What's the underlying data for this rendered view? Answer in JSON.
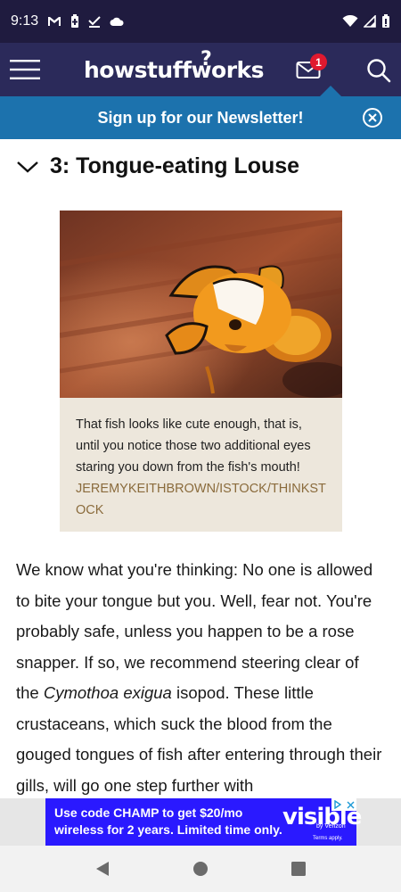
{
  "status_bar": {
    "time": "9:13",
    "left_icons": [
      "gmail-icon",
      "battery-saver-icon",
      "download-done-icon",
      "cloud-icon"
    ],
    "right_icons": [
      "wifi-icon",
      "signal-icon",
      "battery-icon"
    ]
  },
  "header": {
    "logo_text": "howstuffworks",
    "mail_badge_count": "1",
    "colors": {
      "header_bg": "#2b2a5a",
      "status_bg": "#1f1b3f"
    }
  },
  "newsletter": {
    "label": "Sign up for our Newsletter!",
    "color": "#1c72ad"
  },
  "section": {
    "title": "3: Tongue-eating Louse"
  },
  "figure": {
    "caption": "That fish looks like cute enough, that is, until you notice those two additional eyes staring you down from the fish's mouth!",
    "credit": "JEREMYKEITHBROWN/ISTOCK/THINKSTOCK"
  },
  "article": {
    "text_before_italic": "We know what you're thinking: No one is allowed to bite your tongue but you. Well, fear not. You're probably safe, unless you happen to be a rose snapper. If so, we recommend steering clear of the ",
    "italic": "Cymothoa exigua",
    "text_after_italic": " isopod. These little crustaceans, which suck the blood from the gouged tongues of fish after entering through their gills, will go one step further with"
  },
  "ad": {
    "line1": "Use code CHAMP to get $20/mo",
    "line2": "wireless for 2 years. Limited time only.",
    "brand": "visible",
    "sub": "by Verizon",
    "terms": "Terms apply."
  },
  "nav": {
    "buttons": [
      "back-icon",
      "home-icon",
      "recents-icon"
    ]
  }
}
